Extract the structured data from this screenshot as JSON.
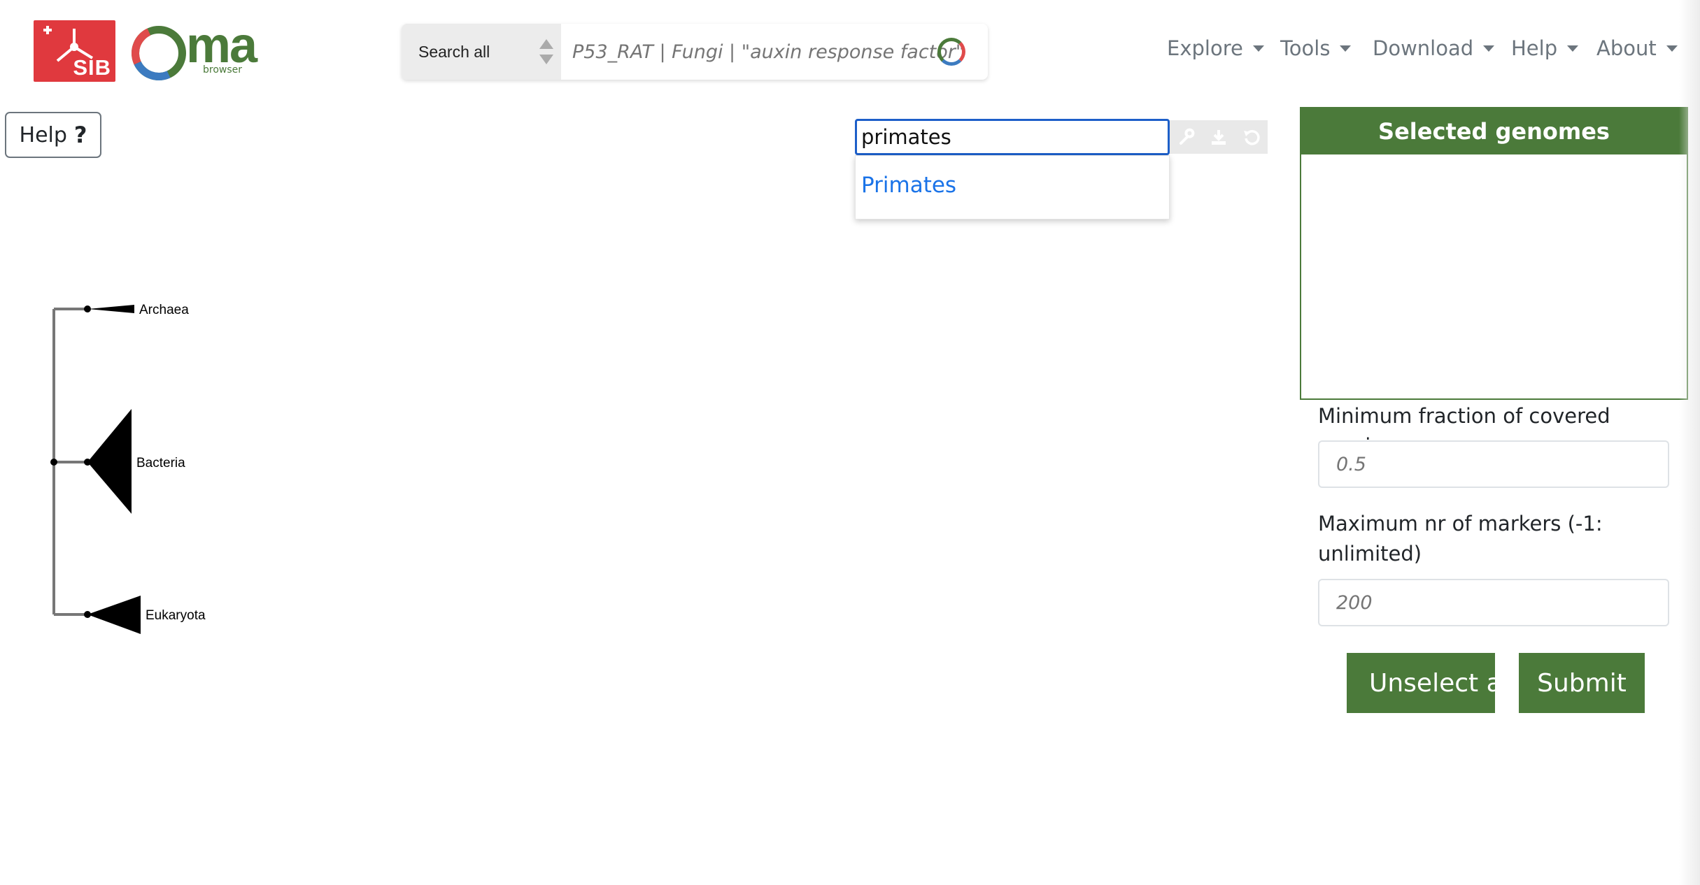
{
  "header": {
    "sib_logo_text": "SIB",
    "oma_logo_word": "ma",
    "oma_logo_sub": "browser",
    "search": {
      "scope_label": "Search all",
      "placeholder": "P53_RAT | Fungi | \"auxin response factor\""
    },
    "nav": [
      {
        "label": "Explore"
      },
      {
        "label": "Tools"
      },
      {
        "label": "Download"
      },
      {
        "label": "Help"
      },
      {
        "label": "About"
      }
    ]
  },
  "help_button": {
    "label": "Help",
    "icon": "question-icon",
    "icon_glyph": "?"
  },
  "tree_search": {
    "value": "primates",
    "tools": [
      "wrench-icon",
      "download-icon",
      "reset-icon"
    ],
    "suggestions": [
      "Primates"
    ]
  },
  "tree": {
    "nodes": [
      "Archaea",
      "Bacteria",
      "Eukaryota"
    ]
  },
  "sidebar": {
    "selected_genomes_title": "Selected genomes",
    "min_fraction_label": "Minimum fraction of covered species",
    "min_fraction_placeholder": "0.5",
    "max_markers_label": "Maximum nr of markers (-1: unlimited)",
    "max_markers_placeholder": "200",
    "unselect_all_label": "Unselect all",
    "submit_label": "Submit"
  },
  "colors": {
    "brand_green": "#4b7a3a",
    "sib_red": "#e0393e",
    "link_blue": "#1a73e8",
    "focus_blue": "#1d5fc9"
  }
}
